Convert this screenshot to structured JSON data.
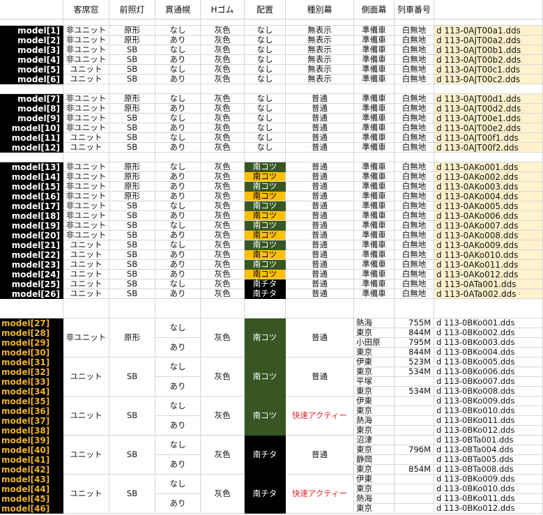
{
  "headers": [
    "客席窓",
    "前照灯",
    "貫通幌",
    "Hゴム",
    "配置",
    "種別幕",
    "側面幕",
    "列車番号"
  ],
  "group1": [
    {
      "model": "model[1]",
      "seat": "非ユニット",
      "light": "原形",
      "hood": "なし",
      "rubber": "灰色",
      "place": "なし",
      "kind": "無表示",
      "side": "準備車",
      "trainno": "白無地",
      "file": "d 113-0AJT00a1.dds"
    },
    {
      "model": "model[2]",
      "seat": "非ユニット",
      "light": "原形",
      "hood": "あり",
      "rubber": "灰色",
      "place": "なし",
      "kind": "無表示",
      "side": "準備車",
      "trainno": "白無地",
      "file": "d 113-0AJT00a2.dds"
    },
    {
      "model": "model[3]",
      "seat": "非ユニット",
      "light": "SB",
      "hood": "なし",
      "rubber": "灰色",
      "place": "なし",
      "kind": "無表示",
      "side": "準備車",
      "trainno": "白無地",
      "file": "d 113-0AJT00b1.dds"
    },
    {
      "model": "model[4]",
      "seat": "非ユニット",
      "light": "SB",
      "hood": "あり",
      "rubber": "灰色",
      "place": "なし",
      "kind": "無表示",
      "side": "準備車",
      "trainno": "白無地",
      "file": "d 113-0AJT00b2.dds"
    },
    {
      "model": "model[5]",
      "seat": "ユニット",
      "light": "SB",
      "hood": "なし",
      "rubber": "灰色",
      "place": "なし",
      "kind": "無表示",
      "side": "準備車",
      "trainno": "白無地",
      "file": "d 113-0AJT00c1.dds"
    },
    {
      "model": "model[6]",
      "seat": "ユニット",
      "light": "SB",
      "hood": "あり",
      "rubber": "灰色",
      "place": "なし",
      "kind": "無表示",
      "side": "準備車",
      "trainno": "白無地",
      "file": "d 113-0AJT00c2.dds"
    }
  ],
  "group2": [
    {
      "model": "model[7]",
      "seat": "非ユニット",
      "light": "原形",
      "hood": "なし",
      "rubber": "灰色",
      "place": "なし",
      "kind": "普通",
      "side": "準備車",
      "trainno": "白無地",
      "file": "d 113-0AJT00d1.dds"
    },
    {
      "model": "model[8]",
      "seat": "非ユニット",
      "light": "原形",
      "hood": "あり",
      "rubber": "灰色",
      "place": "なし",
      "kind": "普通",
      "side": "準備車",
      "trainno": "白無地",
      "file": "d 113-0AJT00d2.dds"
    },
    {
      "model": "model[9]",
      "seat": "非ユニット",
      "light": "SB",
      "hood": "なし",
      "rubber": "灰色",
      "place": "なし",
      "kind": "普通",
      "side": "準備車",
      "trainno": "白無地",
      "file": "d 113-0AJT00e1.dds"
    },
    {
      "model": "model[10]",
      "seat": "非ユニット",
      "light": "SB",
      "hood": "あり",
      "rubber": "灰色",
      "place": "なし",
      "kind": "普通",
      "side": "準備車",
      "trainno": "白無地",
      "file": "d 113-0AJT00e2.dds"
    },
    {
      "model": "model[11]",
      "seat": "ユニット",
      "light": "SB",
      "hood": "なし",
      "rubber": "灰色",
      "place": "なし",
      "kind": "普通",
      "side": "準備車",
      "trainno": "白無地",
      "file": "d 113-0AJT00f1.dds"
    },
    {
      "model": "model[12]",
      "seat": "ユニット",
      "light": "SB",
      "hood": "あり",
      "rubber": "灰色",
      "place": "なし",
      "kind": "普通",
      "side": "準備車",
      "trainno": "白無地",
      "file": "d 113-0AJT00f2.dds"
    }
  ],
  "group3": [
    {
      "model": "model[13]",
      "seat": "非ユニット",
      "light": "原形",
      "hood": "なし",
      "rubber": "灰色",
      "place": "南コツ",
      "pstyle": "gr",
      "kind": "普通",
      "side": "準備車",
      "trainno": "白無地",
      "file": "d 113-0AKo001.dds"
    },
    {
      "model": "model[14]",
      "seat": "非ユニット",
      "light": "原形",
      "hood": "あり",
      "rubber": "灰色",
      "place": "南コツ",
      "pstyle": "yl",
      "kind": "普通",
      "side": "準備車",
      "trainno": "白無地",
      "file": "d 113-0AKo002.dds"
    },
    {
      "model": "model[15]",
      "seat": "非ユニット",
      "light": "原形",
      "hood": "あり",
      "rubber": "灰色",
      "place": "南コツ",
      "pstyle": "gr",
      "kind": "普通",
      "side": "準備車",
      "trainno": "白無地",
      "file": "d 113-0AKo003.dds"
    },
    {
      "model": "model[16]",
      "seat": "非ユニット",
      "light": "原形",
      "hood": "あり",
      "rubber": "灰色",
      "place": "南コツ",
      "pstyle": "yl",
      "kind": "普通",
      "side": "準備車",
      "trainno": "白無地",
      "file": "d 113-0AKo004.dds"
    },
    {
      "model": "model[17]",
      "seat": "非ユニット",
      "light": "SB",
      "hood": "なし",
      "rubber": "灰色",
      "place": "南コツ",
      "pstyle": "gr",
      "kind": "普通",
      "side": "準備車",
      "trainno": "白無地",
      "file": "d 113-0AKo005.dds"
    },
    {
      "model": "model[18]",
      "seat": "非ユニット",
      "light": "SB",
      "hood": "あり",
      "rubber": "灰色",
      "place": "南コツ",
      "pstyle": "yl",
      "kind": "普通",
      "side": "準備車",
      "trainno": "白無地",
      "file": "d 113-0AKo006.dds"
    },
    {
      "model": "model[19]",
      "seat": "非ユニット",
      "light": "SB",
      "hood": "なし",
      "rubber": "灰色",
      "place": "南コツ",
      "pstyle": "gr",
      "kind": "普通",
      "side": "準備車",
      "trainno": "白無地",
      "file": "d 113-0AKo007.dds"
    },
    {
      "model": "model[20]",
      "seat": "非ユニット",
      "light": "SB",
      "hood": "あり",
      "rubber": "灰色",
      "place": "南コツ",
      "pstyle": "yl",
      "kind": "普通",
      "side": "準備車",
      "trainno": "白無地",
      "file": "d 113-0AKo008.dds"
    },
    {
      "model": "model[21]",
      "seat": "ユニット",
      "light": "SB",
      "hood": "なし",
      "rubber": "灰色",
      "place": "南コツ",
      "pstyle": "gr",
      "kind": "普通",
      "side": "準備車",
      "trainno": "白無地",
      "file": "d 113-0AKo009.dds"
    },
    {
      "model": "model[22]",
      "seat": "ユニット",
      "light": "SB",
      "hood": "あり",
      "rubber": "灰色",
      "place": "南コツ",
      "pstyle": "yl",
      "kind": "普通",
      "side": "準備車",
      "trainno": "白無地",
      "file": "d 113-0AKo010.dds"
    },
    {
      "model": "model[23]",
      "seat": "ユニット",
      "light": "SB",
      "hood": "あり",
      "rubber": "灰色",
      "place": "南コツ",
      "pstyle": "gr",
      "kind": "普通",
      "side": "準備車",
      "trainno": "白無地",
      "file": "d 113-0AKo011.dds"
    },
    {
      "model": "model[24]",
      "seat": "ユニット",
      "light": "SB",
      "hood": "あり",
      "rubber": "灰色",
      "place": "南コツ",
      "pstyle": "yl",
      "kind": "普通",
      "side": "準備車",
      "trainno": "白無地",
      "file": "d 113-0AKo012.dds"
    },
    {
      "model": "model[25]",
      "seat": "ユニット",
      "light": "SB",
      "hood": "なし",
      "rubber": "灰色",
      "place": "南チタ",
      "pstyle": "bk",
      "kind": "普通",
      "side": "準備車",
      "trainno": "白無地",
      "file": "d 113-0ATa001.dds"
    },
    {
      "model": "model[26]",
      "seat": "ユニット",
      "light": "SB",
      "hood": "あり",
      "rubber": "灰色",
      "place": "南チタ",
      "pstyle": "bk",
      "kind": "普通",
      "side": "準備車",
      "trainno": "白無地",
      "file": "d 113-0ATa002.dds"
    }
  ],
  "group4": [
    {
      "seat": "非ユニット",
      "light": "原形",
      "rubber": "灰色",
      "place": "南コツ",
      "pstyle": "gr",
      "kind": "普通",
      "kstyle": "",
      "rows": [
        {
          "model": "model[27]",
          "side": "熱海",
          "trainno": "755M",
          "file": "d 113-0BKo001.dds"
        },
        {
          "model": "model[28]",
          "side": "東京",
          "trainno": "844M",
          "file": "d 113-0BKo002.dds"
        },
        {
          "model": "model[29]",
          "side": "小田原",
          "trainno": "795M",
          "file": "d 113-0BKo003.dds"
        },
        {
          "model": "model[30]",
          "side": "東京",
          "trainno": "844M",
          "file": "d 113-0BKo004.dds"
        }
      ]
    },
    {
      "seat": "ユニット",
      "light": "SB",
      "rubber": "灰色",
      "place": "南コツ",
      "pstyle": "gr",
      "kind": "普通",
      "kstyle": "",
      "rows": [
        {
          "model": "model[31]",
          "side": "伊東",
          "trainno": "523M",
          "file": "d 113-0BKo005.dds"
        },
        {
          "model": "model[32]",
          "side": "東京",
          "trainno": "534M",
          "file": "d 113-0BKo006.dds"
        },
        {
          "model": "model[33]",
          "side": "平塚",
          "trainno": "",
          "file": "d 113-0BKo007.dds"
        },
        {
          "model": "model[34]",
          "side": "東京",
          "trainno": "534M",
          "file": "d 113-0BKo008.dds"
        }
      ]
    },
    {
      "seat": "ユニット",
      "light": "SB",
      "rubber": "灰色",
      "place": "南コツ",
      "pstyle": "gr",
      "kind": "快速アクティー",
      "kstyle": "red",
      "rows": [
        {
          "model": "model[35]",
          "side": "伊東",
          "trainno": "",
          "file": "d 113-0BKo009.dds"
        },
        {
          "model": "model[36]",
          "side": "東京",
          "trainno": "",
          "file": "d 113-0BKo010.dds"
        },
        {
          "model": "model[37]",
          "side": "熱海",
          "trainno": "",
          "file": "d 113-0BKo011.dds"
        },
        {
          "model": "model[38]",
          "side": "東京",
          "trainno": "",
          "file": "d 113-0BKo012.dds"
        }
      ]
    },
    {
      "seat": "ユニット",
      "light": "SB",
      "rubber": "灰色",
      "place": "南チタ",
      "pstyle": "bk",
      "kind": "普通",
      "kstyle": "",
      "rows": [
        {
          "model": "model[39]",
          "side": "沼津",
          "trainno": "",
          "file": "d 113-0BTa001.dds"
        },
        {
          "model": "model[40]",
          "side": "東京",
          "trainno": "796M",
          "file": "d 113-0BTa004.dds"
        },
        {
          "model": "model[41]",
          "side": "静岡",
          "trainno": "",
          "file": "d 113-0BTa005.dds"
        },
        {
          "model": "model[42]",
          "side": "東京",
          "trainno": "854M",
          "file": "d 113-0BTa008.dds"
        }
      ]
    },
    {
      "seat": "ユニット",
      "light": "SB",
      "rubber": "灰色",
      "place": "南チタ",
      "pstyle": "bk",
      "kind": "快速アクティー",
      "kstyle": "red",
      "rows": [
        {
          "model": "model[43]",
          "side": "伊東",
          "trainno": "",
          "file": "d 113-0BKo009.dds"
        },
        {
          "model": "model[44]",
          "side": "東京",
          "trainno": "",
          "file": "d 113-0BKo010.dds"
        },
        {
          "model": "model[45]",
          "side": "熱海",
          "trainno": "",
          "file": "d 113-0BKo011.dds"
        },
        {
          "model": "model[46]",
          "side": "東京",
          "trainno": "",
          "file": "d 113-0BKo012.dds"
        }
      ]
    }
  ],
  "hood_values": [
    "なし",
    "あり"
  ]
}
